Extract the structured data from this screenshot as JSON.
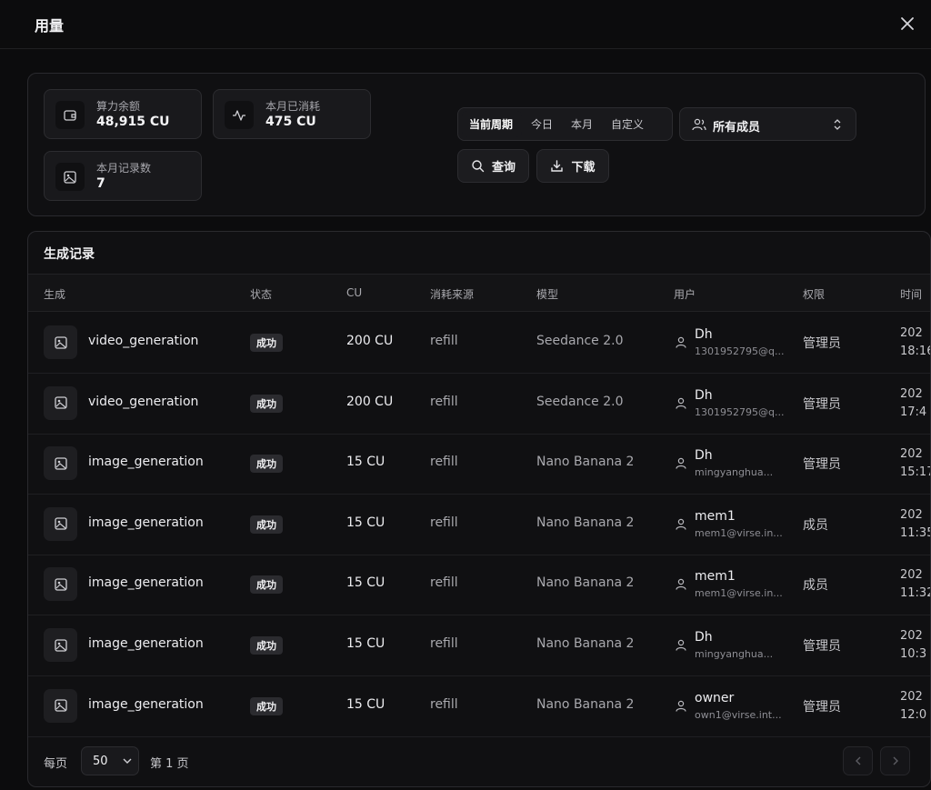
{
  "header": {
    "title": "用量"
  },
  "stats": [
    {
      "icon": "wallet-icon",
      "label": "算力余额",
      "value": "48,915 CU"
    },
    {
      "icon": "activity-icon",
      "label": "本月已消耗",
      "value": "475 CU"
    },
    {
      "icon": "image-icon",
      "label": "本月记录数",
      "value": "7"
    }
  ],
  "filters": {
    "tabs": [
      "当前周期",
      "今日",
      "本月",
      "自定义"
    ],
    "active_tab": "当前周期",
    "member_select": "所有成员",
    "query_label": "查询",
    "download_label": "下载"
  },
  "records": {
    "title": "生成记录",
    "columns": [
      "生成",
      "状态",
      "CU",
      "消耗来源",
      "模型",
      "用户",
      "权限",
      "时间"
    ],
    "rows": [
      {
        "name": "video_generation",
        "status": "成功",
        "cu": "200 CU",
        "source": "refill",
        "model": "Seedance 2.0",
        "user": "Dh",
        "email": "1301952795@q...",
        "role": "管理员",
        "time_a": "202",
        "time_b": "18:16"
      },
      {
        "name": "video_generation",
        "status": "成功",
        "cu": "200 CU",
        "source": "refill",
        "model": "Seedance 2.0",
        "user": "Dh",
        "email": "1301952795@q...",
        "role": "管理员",
        "time_a": "202",
        "time_b": "17:4"
      },
      {
        "name": "image_generation",
        "status": "成功",
        "cu": "15 CU",
        "source": "refill",
        "model": "Nano Banana 2",
        "user": "Dh",
        "email": "mingyanghua...",
        "role": "管理员",
        "time_a": "202",
        "time_b": "15:17"
      },
      {
        "name": "image_generation",
        "status": "成功",
        "cu": "15 CU",
        "source": "refill",
        "model": "Nano Banana 2",
        "user": "mem1",
        "email": "mem1@virse.in...",
        "role": "成员",
        "time_a": "202",
        "time_b": "11:35"
      },
      {
        "name": "image_generation",
        "status": "成功",
        "cu": "15 CU",
        "source": "refill",
        "model": "Nano Banana 2",
        "user": "mem1",
        "email": "mem1@virse.in...",
        "role": "成员",
        "time_a": "202",
        "time_b": "11:32"
      },
      {
        "name": "image_generation",
        "status": "成功",
        "cu": "15 CU",
        "source": "refill",
        "model": "Nano Banana 2",
        "user": "Dh",
        "email": "mingyanghua...",
        "role": "管理员",
        "time_a": "202",
        "time_b": "10:3"
      },
      {
        "name": "image_generation",
        "status": "成功",
        "cu": "15 CU",
        "source": "refill",
        "model": "Nano Banana 2",
        "user": "owner",
        "email": "own1@virse.int...",
        "role": "管理员",
        "time_a": "202",
        "time_b": "12:0"
      }
    ]
  },
  "pagination": {
    "per_page_label": "每页",
    "per_page_value": "50",
    "page_label": "第 1 页"
  }
}
